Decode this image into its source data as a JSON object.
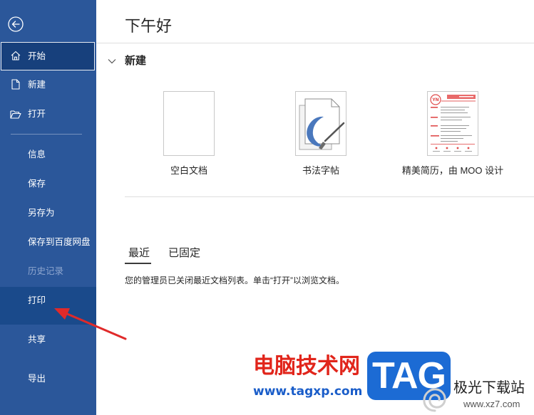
{
  "sidebar": {
    "back_icon": "back-arrow-icon",
    "items": [
      {
        "label": "开始",
        "icon": "home-icon",
        "selected": true
      },
      {
        "label": "新建",
        "icon": "new-document-icon"
      },
      {
        "label": "打开",
        "icon": "folder-open-icon"
      },
      {
        "label": "信息"
      },
      {
        "label": "保存"
      },
      {
        "label": "另存为"
      },
      {
        "label": "保存到百度网盘"
      },
      {
        "label": "历史记录",
        "disabled": true
      },
      {
        "label": "打印",
        "highlighted": true
      },
      {
        "label": "共享"
      },
      {
        "label": "导出"
      }
    ]
  },
  "main": {
    "greeting": "下午好",
    "new_section": {
      "title": "新建",
      "toggle_icon": "chevron-down-icon",
      "templates": [
        {
          "label": "空白文档"
        },
        {
          "label": "书法字帖",
          "icon": "calligraphy-brush-icon"
        },
        {
          "label": "精美简历，由 MOO 设计",
          "thumbnail_text": "YN"
        }
      ]
    },
    "recent": {
      "tabs": [
        {
          "label": "最近",
          "selected": true
        },
        {
          "label": "已固定"
        }
      ],
      "message": "您的管理员已关闭最近文档列表。单击“打开”以浏览文档。"
    }
  },
  "watermark": {
    "site_name": "电脑技术网",
    "site_url": "www.tagxp.com",
    "logo_text": "TAG",
    "site2_name": "极光下载站",
    "site2_url": "www.xz7.com",
    "site2_logo_icon": "swirl-logo-icon"
  },
  "colors": {
    "sidebar_bg": "#2b579a",
    "sidebar_selected_bg": "#17407c",
    "sidebar_highlight_bg": "#1a4a8b",
    "sidebar_disabled_text": "#8ea6cf",
    "annotation_arrow": "#e02a2a",
    "watermark_red": "#e1251b",
    "watermark_blue": "#1a5dc9",
    "tag_logo_bg": "#1c6bd4"
  }
}
